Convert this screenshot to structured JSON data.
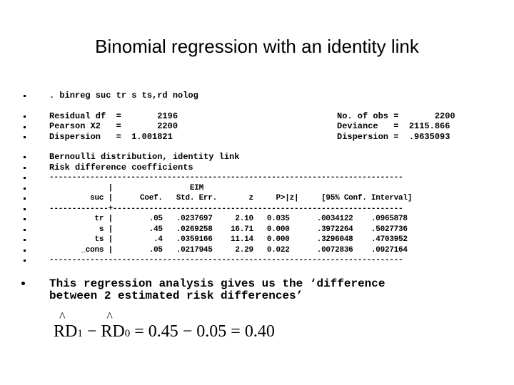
{
  "slide": {
    "title": "Binomial regression with an identity link"
  },
  "command": ". binreg suc tr s ts,rd nolog",
  "stats_left": [
    "Residual df  =       2196",
    "Pearson X2   =       2200",
    "Dispersion   =  1.001821"
  ],
  "stats_right": [
    "No. of obs =       2200",
    "Deviance   =  2115.866",
    "Dispersion =  .9635093"
  ],
  "model": {
    "distribution_line": "Bernoulli distribution, identity link",
    "coef_type_line": "Risk difference coefficients"
  },
  "table": {
    "rule_top": "------------------------------------------------------------------------------",
    "header1": "             |                 EIM",
    "header2": "         suc |      Coef.   Std. Err.       z     P>|z|     [95% Conf. Interval]",
    "rule_mid": "-------------+----------------------------------------------------------------",
    "rule_bottom": "------------------------------------------------------------------------------",
    "rows": [
      {
        "var": "tr",
        "coef": ".05",
        "se": ".0237697",
        "z": "2.10",
        "p": "0.035",
        "ci_low": ".0034122",
        "ci_high": ".0965878",
        "text": "          tr |        .05   .0237697     2.10   0.035      .0034122    .0965878"
      },
      {
        "var": "s",
        "coef": ".45",
        "se": ".0269258",
        "z": "16.71",
        "p": "0.000",
        "ci_low": ".3972264",
        "ci_high": ".5027736",
        "text": "           s |        .45   .0269258    16.71   0.000      .3972264    .5027736"
      },
      {
        "var": "ts",
        "coef": ".4",
        "se": ".0359166",
        "z": "11.14",
        "p": "0.000",
        "ci_low": ".3296048",
        "ci_high": ".4703952",
        "text": "          ts |         .4   .0359166    11.14   0.000      .3296048    .4703952"
      },
      {
        "var": "_cons",
        "coef": ".05",
        "se": ".0217945",
        "z": "2.29",
        "p": "0.022",
        "ci_low": ".0072836",
        "ci_high": ".0927164",
        "text": "       _cons |        .05   .0217945     2.29   0.022      .0072836    .0927164"
      }
    ]
  },
  "note": {
    "line1": "This regression analysis gives us the ‘difference",
    "line2": "between 2 estimated risk differences’"
  },
  "formula": {
    "hat": "^",
    "term1": "RD",
    "sub1": "1",
    "minus1": " − ",
    "term2": "RD",
    "sub2": "0",
    "rest": " = 0.45 − 0.05 = 0.40"
  }
}
